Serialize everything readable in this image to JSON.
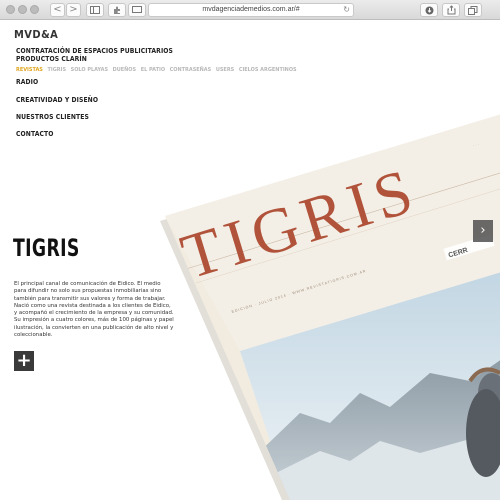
{
  "browser": {
    "url": "mvdagenciademedios.com.ar/#",
    "back_label": "<",
    "forward_label": ">"
  },
  "header": {
    "logo": "MVD&A"
  },
  "nav": {
    "top_item": "CONTRATACIÓN DE ESPACIOS PUBLICITARIOS",
    "section": "PRODUCTOS CLARÍN",
    "subitems": [
      "REVISTAS",
      "TIGRIS",
      "SOLO PLAYAS",
      "DUEÑOS",
      "EL PATIO",
      "CONTRASEÑAS",
      "USERS",
      "CIELOS ARGENTINOS"
    ],
    "active_subitem": "REVISTAS",
    "radio": "RADIO",
    "items": [
      "CREATIVIDAD Y DISEÑO",
      "NUESTROS CLIENTES",
      "CONTACTO"
    ]
  },
  "content": {
    "title": "TIGRIS",
    "description": "El principal canal de comunicación de Eidico. El medio para difundir no solo sus propuestas inmobiliarias sino también para transmitir sus valores y forma de trabajar. Nació como una revista destinada a los clientes de Eidico, y acompañó el crecimiento de la empresa y su comunidad.\nSu impresión a cuatro colores, más de 100 páginas y papel ilustración, la convierten en una publicación de alto nivel y coleccionable.",
    "plus_label": "+",
    "next_label": "›"
  },
  "magazine": {
    "title": "TIGRIS",
    "title_color": "#b0533a",
    "edition_text": "EDICIÓN · JULIO 2014 · WWW.REVISTATIGRIS.COM.AR",
    "side_text": "CERR"
  }
}
